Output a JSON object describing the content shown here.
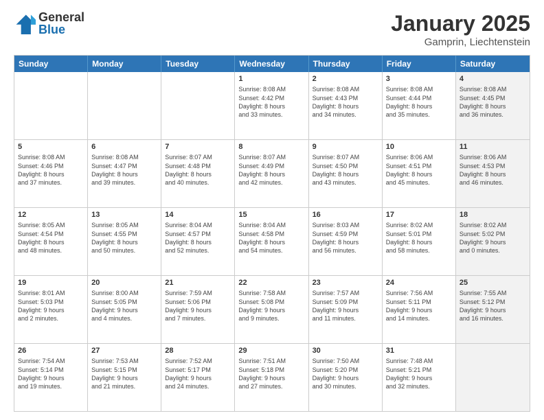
{
  "logo": {
    "general": "General",
    "blue": "Blue"
  },
  "title": "January 2025",
  "location": "Gamprin, Liechtenstein",
  "weekdays": [
    "Sunday",
    "Monday",
    "Tuesday",
    "Wednesday",
    "Thursday",
    "Friday",
    "Saturday"
  ],
  "rows": [
    [
      {
        "day": "",
        "info": "",
        "shaded": false
      },
      {
        "day": "",
        "info": "",
        "shaded": false
      },
      {
        "day": "",
        "info": "",
        "shaded": false
      },
      {
        "day": "1",
        "info": "Sunrise: 8:08 AM\nSunset: 4:42 PM\nDaylight: 8 hours\nand 33 minutes.",
        "shaded": false
      },
      {
        "day": "2",
        "info": "Sunrise: 8:08 AM\nSunset: 4:43 PM\nDaylight: 8 hours\nand 34 minutes.",
        "shaded": false
      },
      {
        "day": "3",
        "info": "Sunrise: 8:08 AM\nSunset: 4:44 PM\nDaylight: 8 hours\nand 35 minutes.",
        "shaded": false
      },
      {
        "day": "4",
        "info": "Sunrise: 8:08 AM\nSunset: 4:45 PM\nDaylight: 8 hours\nand 36 minutes.",
        "shaded": true
      }
    ],
    [
      {
        "day": "5",
        "info": "Sunrise: 8:08 AM\nSunset: 4:46 PM\nDaylight: 8 hours\nand 37 minutes.",
        "shaded": false
      },
      {
        "day": "6",
        "info": "Sunrise: 8:08 AM\nSunset: 4:47 PM\nDaylight: 8 hours\nand 39 minutes.",
        "shaded": false
      },
      {
        "day": "7",
        "info": "Sunrise: 8:07 AM\nSunset: 4:48 PM\nDaylight: 8 hours\nand 40 minutes.",
        "shaded": false
      },
      {
        "day": "8",
        "info": "Sunrise: 8:07 AM\nSunset: 4:49 PM\nDaylight: 8 hours\nand 42 minutes.",
        "shaded": false
      },
      {
        "day": "9",
        "info": "Sunrise: 8:07 AM\nSunset: 4:50 PM\nDaylight: 8 hours\nand 43 minutes.",
        "shaded": false
      },
      {
        "day": "10",
        "info": "Sunrise: 8:06 AM\nSunset: 4:51 PM\nDaylight: 8 hours\nand 45 minutes.",
        "shaded": false
      },
      {
        "day": "11",
        "info": "Sunrise: 8:06 AM\nSunset: 4:53 PM\nDaylight: 8 hours\nand 46 minutes.",
        "shaded": true
      }
    ],
    [
      {
        "day": "12",
        "info": "Sunrise: 8:05 AM\nSunset: 4:54 PM\nDaylight: 8 hours\nand 48 minutes.",
        "shaded": false
      },
      {
        "day": "13",
        "info": "Sunrise: 8:05 AM\nSunset: 4:55 PM\nDaylight: 8 hours\nand 50 minutes.",
        "shaded": false
      },
      {
        "day": "14",
        "info": "Sunrise: 8:04 AM\nSunset: 4:57 PM\nDaylight: 8 hours\nand 52 minutes.",
        "shaded": false
      },
      {
        "day": "15",
        "info": "Sunrise: 8:04 AM\nSunset: 4:58 PM\nDaylight: 8 hours\nand 54 minutes.",
        "shaded": false
      },
      {
        "day": "16",
        "info": "Sunrise: 8:03 AM\nSunset: 4:59 PM\nDaylight: 8 hours\nand 56 minutes.",
        "shaded": false
      },
      {
        "day": "17",
        "info": "Sunrise: 8:02 AM\nSunset: 5:01 PM\nDaylight: 8 hours\nand 58 minutes.",
        "shaded": false
      },
      {
        "day": "18",
        "info": "Sunrise: 8:02 AM\nSunset: 5:02 PM\nDaylight: 9 hours\nand 0 minutes.",
        "shaded": true
      }
    ],
    [
      {
        "day": "19",
        "info": "Sunrise: 8:01 AM\nSunset: 5:03 PM\nDaylight: 9 hours\nand 2 minutes.",
        "shaded": false
      },
      {
        "day": "20",
        "info": "Sunrise: 8:00 AM\nSunset: 5:05 PM\nDaylight: 9 hours\nand 4 minutes.",
        "shaded": false
      },
      {
        "day": "21",
        "info": "Sunrise: 7:59 AM\nSunset: 5:06 PM\nDaylight: 9 hours\nand 7 minutes.",
        "shaded": false
      },
      {
        "day": "22",
        "info": "Sunrise: 7:58 AM\nSunset: 5:08 PM\nDaylight: 9 hours\nand 9 minutes.",
        "shaded": false
      },
      {
        "day": "23",
        "info": "Sunrise: 7:57 AM\nSunset: 5:09 PM\nDaylight: 9 hours\nand 11 minutes.",
        "shaded": false
      },
      {
        "day": "24",
        "info": "Sunrise: 7:56 AM\nSunset: 5:11 PM\nDaylight: 9 hours\nand 14 minutes.",
        "shaded": false
      },
      {
        "day": "25",
        "info": "Sunrise: 7:55 AM\nSunset: 5:12 PM\nDaylight: 9 hours\nand 16 minutes.",
        "shaded": true
      }
    ],
    [
      {
        "day": "26",
        "info": "Sunrise: 7:54 AM\nSunset: 5:14 PM\nDaylight: 9 hours\nand 19 minutes.",
        "shaded": false
      },
      {
        "day": "27",
        "info": "Sunrise: 7:53 AM\nSunset: 5:15 PM\nDaylight: 9 hours\nand 21 minutes.",
        "shaded": false
      },
      {
        "day": "28",
        "info": "Sunrise: 7:52 AM\nSunset: 5:17 PM\nDaylight: 9 hours\nand 24 minutes.",
        "shaded": false
      },
      {
        "day": "29",
        "info": "Sunrise: 7:51 AM\nSunset: 5:18 PM\nDaylight: 9 hours\nand 27 minutes.",
        "shaded": false
      },
      {
        "day": "30",
        "info": "Sunrise: 7:50 AM\nSunset: 5:20 PM\nDaylight: 9 hours\nand 30 minutes.",
        "shaded": false
      },
      {
        "day": "31",
        "info": "Sunrise: 7:48 AM\nSunset: 5:21 PM\nDaylight: 9 hours\nand 32 minutes.",
        "shaded": false
      },
      {
        "day": "",
        "info": "",
        "shaded": true
      }
    ]
  ]
}
